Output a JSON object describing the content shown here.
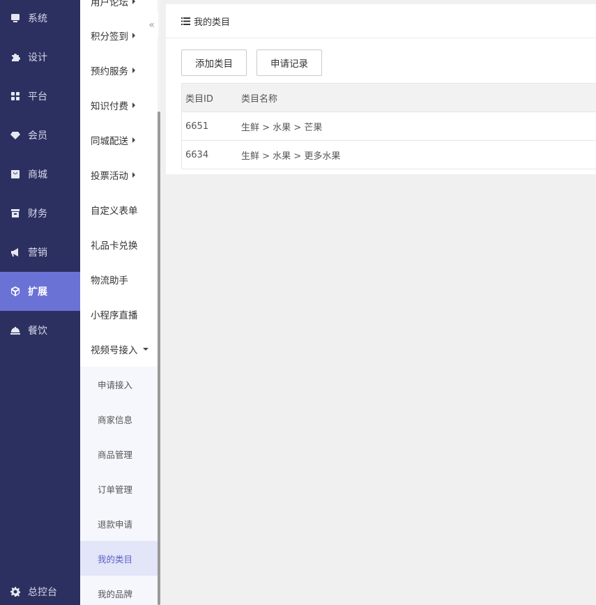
{
  "nav_primary": [
    {
      "label": "系统",
      "icon": "monitor-icon"
    },
    {
      "label": "设计",
      "icon": "puzzle-icon"
    },
    {
      "label": "平台",
      "icon": "grid-icon"
    },
    {
      "label": "会员",
      "icon": "gem-icon"
    },
    {
      "label": "商城",
      "icon": "bag-icon"
    },
    {
      "label": "财务",
      "icon": "archive-icon"
    },
    {
      "label": "营销",
      "icon": "megaphone-icon"
    },
    {
      "label": "扩展",
      "icon": "cube-icon",
      "active": true
    },
    {
      "label": "餐饮",
      "icon": "cloche-icon"
    }
  ],
  "nav_console": {
    "label": "总控台",
    "icon": "gear-icon"
  },
  "nav_secondary": [
    {
      "label": "用户论坛",
      "has_arrow": true
    },
    {
      "label": "积分签到",
      "has_arrow": true
    },
    {
      "label": "预约服务",
      "has_arrow": true
    },
    {
      "label": "知识付费",
      "has_arrow": true
    },
    {
      "label": "同城配送",
      "has_arrow": true
    },
    {
      "label": "投票活动",
      "has_arrow": true
    },
    {
      "label": "自定义表单"
    },
    {
      "label": "礼品卡兑换"
    },
    {
      "label": "物流助手"
    },
    {
      "label": "小程序直播"
    },
    {
      "label": "视频号接入",
      "expanded": true
    }
  ],
  "nav_sub": [
    {
      "label": "申请接入"
    },
    {
      "label": "商家信息"
    },
    {
      "label": "商品管理"
    },
    {
      "label": "订单管理"
    },
    {
      "label": "退款申请"
    },
    {
      "label": "我的类目",
      "active": true
    },
    {
      "label": "我的品牌"
    }
  ],
  "collapse_glyph": "«",
  "panel": {
    "title": "我的类目",
    "title_icon": "list-icon",
    "buttons": {
      "add": "添加类目",
      "records": "申请记录"
    },
    "table": {
      "headers": [
        "类目ID",
        "类目名称"
      ],
      "rows": [
        [
          "6651",
          "生鲜 > 水果 > 芒果"
        ],
        [
          "6634",
          "生鲜 > 水果 > 更多水果"
        ]
      ]
    }
  },
  "colors": {
    "sidebar_bg": "#2c3060",
    "accent": "#6b72d6",
    "sub_active_bg": "#e3e5f8"
  }
}
